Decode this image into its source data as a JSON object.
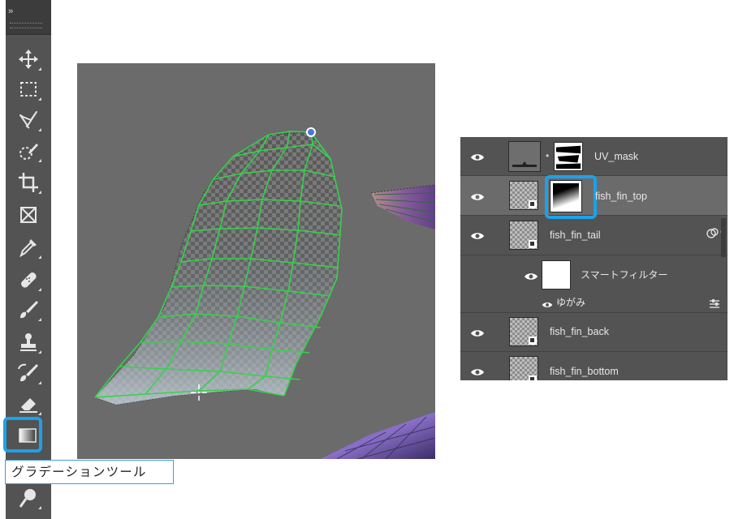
{
  "toolbar": {
    "expand_glyph": "››",
    "tools": [
      {
        "name": "move-tool",
        "icon": "move-icon"
      },
      {
        "name": "marquee-tool",
        "icon": "marquee-icon"
      },
      {
        "name": "lasso-tool",
        "icon": "lasso-icon"
      },
      {
        "name": "quick-selection-tool",
        "icon": "quick-selection-icon"
      },
      {
        "name": "crop-tool",
        "icon": "crop-icon"
      },
      {
        "name": "frame-tool",
        "icon": "frame-icon"
      },
      {
        "name": "eyedropper-tool",
        "icon": "eyedropper-icon"
      },
      {
        "name": "healing-brush-tool",
        "icon": "bandage-icon"
      },
      {
        "name": "brush-tool",
        "icon": "brush-icon"
      },
      {
        "name": "clone-stamp-tool",
        "icon": "stamp-icon"
      },
      {
        "name": "history-brush-tool",
        "icon": "history-brush-icon"
      },
      {
        "name": "eraser-tool",
        "icon": "eraser-icon"
      },
      {
        "name": "gradient-tool",
        "icon": "gradient-icon",
        "active": true
      },
      {
        "name": "dodge-tool",
        "icon": "dodge-icon"
      }
    ],
    "tooltip": "グラデーションツール"
  },
  "layers": [
    {
      "name": "UV_mask",
      "visible": true,
      "has_mask": true
    },
    {
      "name": "fish_fin_top",
      "visible": true,
      "selected": true,
      "has_mask": true,
      "mask_highlighted": true
    },
    {
      "name": "fish_fin_tail",
      "visible": true,
      "smart_object": true
    },
    {
      "name": "スマートフィルター",
      "visible": true,
      "type": "smart-filter"
    },
    {
      "name": "ゆがみ",
      "visible": true,
      "type": "filter"
    },
    {
      "name": "fish_fin_back",
      "visible": true,
      "smart_object": true
    },
    {
      "name": "fish_fin_bottom",
      "visible": true,
      "smart_object": true
    }
  ],
  "colors": {
    "highlight": "#1da1e8",
    "panel_bg": "#535353",
    "selected_row": "#6b6b6b",
    "mesh": "#35d24a",
    "canvas_bg": "#6b6b6b"
  }
}
